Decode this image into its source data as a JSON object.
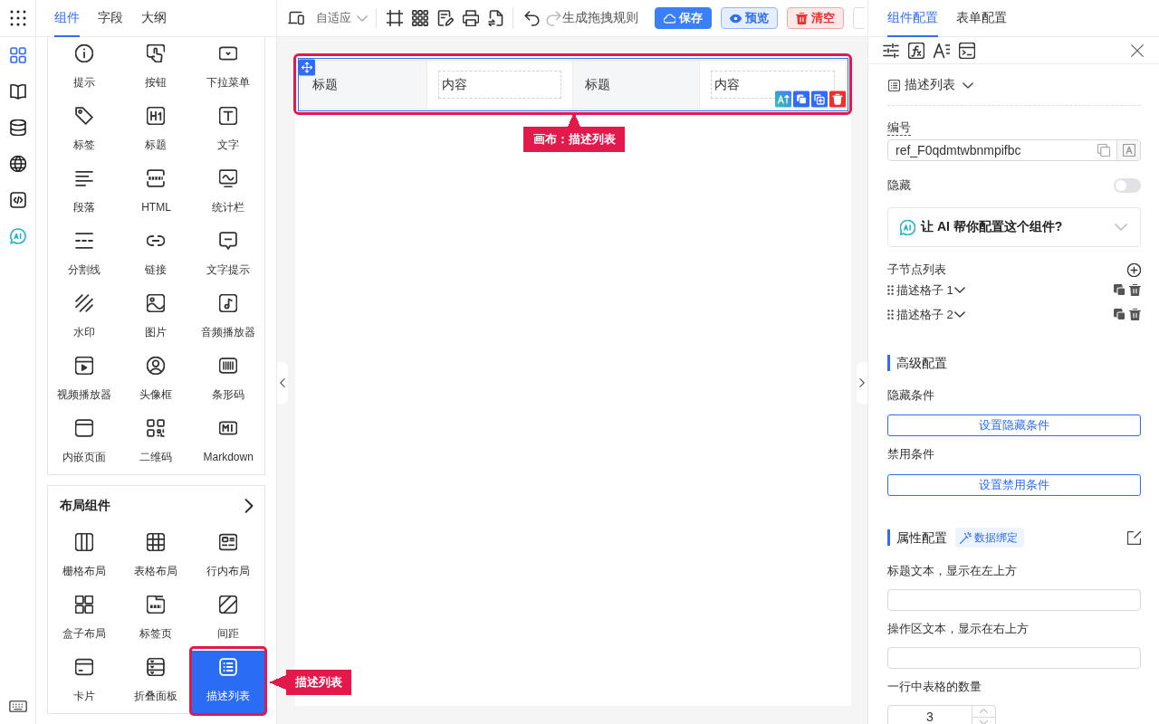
{
  "rail": {
    "items": [
      {
        "selected": true
      },
      {
        "selected": false
      },
      {
        "selected": false
      },
      {
        "selected": false
      },
      {
        "selected": false
      },
      {
        "selected": false
      }
    ]
  },
  "palette": {
    "tabs": [
      {
        "label": "组件",
        "selected": true
      },
      {
        "label": "字段",
        "selected": false
      },
      {
        "label": "大纲",
        "selected": false
      }
    ],
    "basic": {
      "items": [
        {
          "label": "提示",
          "selected": false
        },
        {
          "label": "按钮",
          "selected": false
        },
        {
          "label": "下拉菜单",
          "selected": false
        },
        {
          "label": "标签",
          "selected": false
        },
        {
          "label": "标题",
          "selected": false
        },
        {
          "label": "文字",
          "selected": false
        },
        {
          "label": "段落",
          "selected": false
        },
        {
          "label": "HTML",
          "selected": false
        },
        {
          "label": "统计栏",
          "selected": false
        },
        {
          "label": "分割线",
          "selected": false
        },
        {
          "label": "链接",
          "selected": false
        },
        {
          "label": "文字提示",
          "selected": false
        },
        {
          "label": "水印",
          "selected": false
        },
        {
          "label": "图片",
          "selected": false
        },
        {
          "label": "音频播放器",
          "selected": false
        },
        {
          "label": "视频播放器",
          "selected": false
        },
        {
          "label": "头像框",
          "selected": false
        },
        {
          "label": "条形码",
          "selected": false
        },
        {
          "label": "内嵌页面",
          "selected": false
        },
        {
          "label": "二维码",
          "selected": false
        },
        {
          "label": "Markdown",
          "selected": false
        }
      ]
    },
    "layout": {
      "title": "布局组件",
      "callout": "描述列表",
      "items": [
        {
          "label": "栅格布局",
          "selected": false
        },
        {
          "label": "表格布局",
          "selected": false
        },
        {
          "label": "行内布局",
          "selected": false
        },
        {
          "label": "盒子布局",
          "selected": false
        },
        {
          "label": "标签页",
          "selected": false
        },
        {
          "label": "间距",
          "selected": false
        },
        {
          "label": "卡片",
          "selected": false
        },
        {
          "label": "折叠面板",
          "selected": false
        },
        {
          "label": "描述列表",
          "selected": true
        }
      ]
    }
  },
  "toolbar": {
    "mode": "自适应",
    "undo": {
      "disabled": false
    },
    "redo": {
      "disabled": true
    },
    "rule_button": "生成拖拽规则",
    "buttons": [
      {
        "kind": "primary",
        "label": "保存"
      },
      {
        "kind": "info",
        "label": "预览"
      },
      {
        "kind": "danger",
        "label": "清空"
      }
    ]
  },
  "canvas": {
    "callout": "画布：描述列表",
    "description_list": {
      "selected": true,
      "cells": [
        {
          "kind": "label",
          "text": "标题"
        },
        {
          "kind": "content",
          "text": "内容"
        },
        {
          "kind": "label",
          "text": "标题"
        },
        {
          "kind": "content",
          "text": "内容"
        }
      ]
    }
  },
  "config_panel": {
    "tabs": [
      {
        "label": "组件配置",
        "selected": true
      },
      {
        "label": "表单配置",
        "selected": false
      }
    ],
    "component_type": "描述列表",
    "ref_field": {
      "label": "编号",
      "value": "ref_F0qdmtwbnmpifbc"
    },
    "hidden": {
      "label": "隐藏",
      "on": false
    },
    "ai_assist": "让 AI 帮你配置这个组件?",
    "children": {
      "title": "子节点列表",
      "items": [
        {
          "label": "描述格子 1"
        },
        {
          "label": "描述格子 2"
        }
      ]
    },
    "advanced": {
      "title": "高级配置",
      "conditions": [
        {
          "label": "隐藏条件",
          "button": "设置隐藏条件"
        },
        {
          "label": "禁用条件",
          "button": "设置禁用条件"
        }
      ]
    },
    "properties": {
      "title": "属性配置",
      "tag": "数据绑定",
      "fields": [
        {
          "kind": "text",
          "label": "标题文本，显示在左上方"
        },
        {
          "kind": "text",
          "label": "操作区文本，显示在右上方"
        },
        {
          "kind": "number",
          "label": "一行中表格的数量",
          "value": "3"
        }
      ]
    }
  }
}
